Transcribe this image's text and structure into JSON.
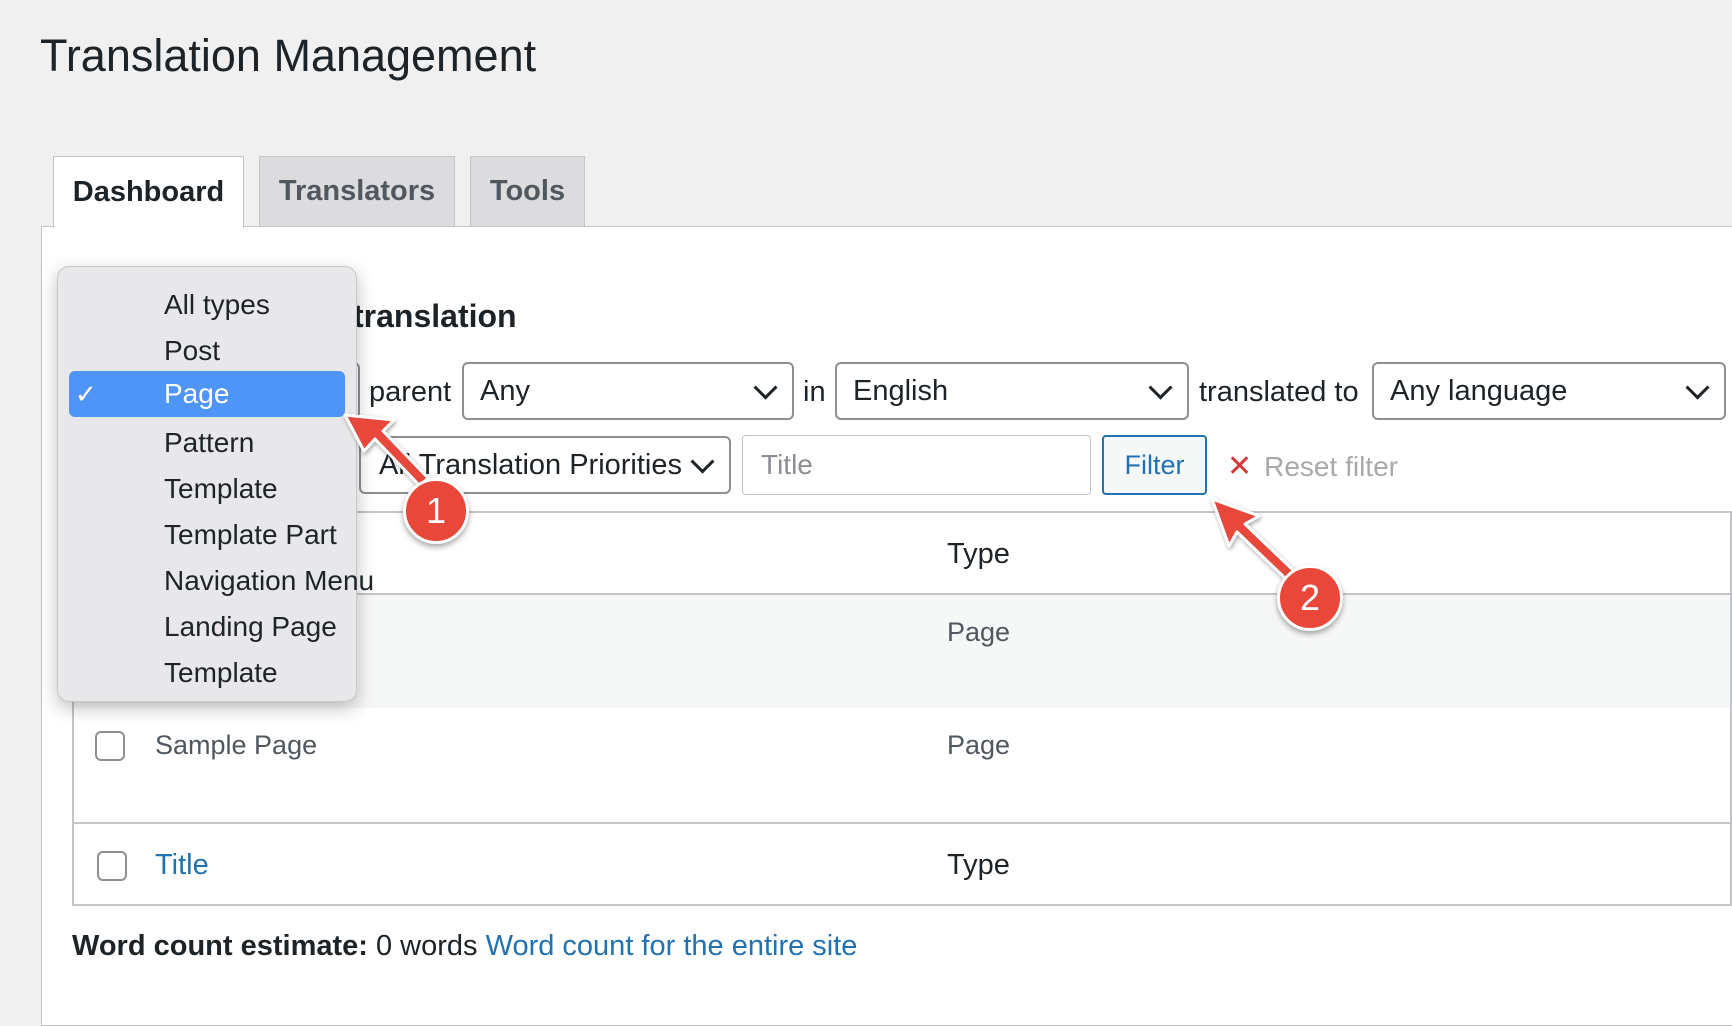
{
  "page_title": "Translation Management",
  "tabs": [
    {
      "label": "Dashboard",
      "active": true
    },
    {
      "label": "Translators",
      "active": false
    },
    {
      "label": "Tools",
      "active": false
    }
  ],
  "section_title": "translation",
  "filters": {
    "parent_label": "parent",
    "parent_value": "Any",
    "in_label": "in",
    "language_value": "English",
    "translated_to_label": "translated to",
    "target_language_value": "Any language",
    "priority_value": "All Translation Priorities",
    "title_placeholder": "Title",
    "filter_button": "Filter",
    "reset_label": "Reset filter"
  },
  "type_dropdown": {
    "options": [
      "All types",
      "Post",
      "Page",
      "Pattern",
      "Template",
      "Template Part",
      "Navigation Menu",
      "Landing Page",
      "Template"
    ],
    "selected": "Page",
    "check_glyph": "✓"
  },
  "table": {
    "header_type": "Type",
    "rows": [
      {
        "title": "",
        "type": "Page"
      },
      {
        "title": "Sample Page",
        "type": "Page"
      }
    ],
    "footer_title": "Title",
    "footer_type": "Type"
  },
  "word_count": {
    "label": "Word count estimate:",
    "value": "0 words",
    "link": "Word count for the entire site"
  },
  "annotations": [
    "1",
    "2"
  ],
  "colors": {
    "accent": "#2271b1",
    "badge": "#e8473a",
    "selected": "#4f95f7"
  }
}
